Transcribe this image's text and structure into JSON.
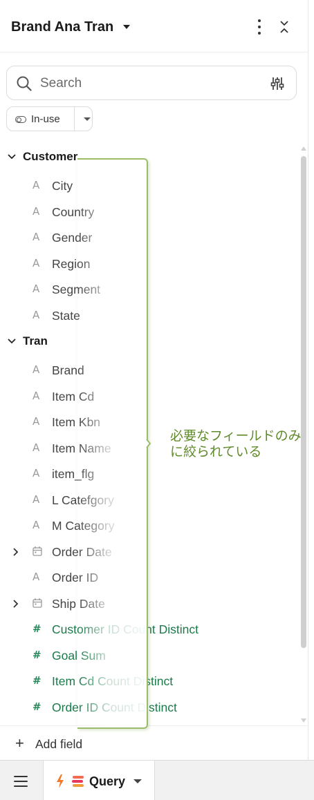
{
  "header": {
    "title": "Brand Ana Tran",
    "icons": [
      "caret-down-icon",
      "more-vert-icon",
      "collapse-icon"
    ]
  },
  "search": {
    "placeholder": "Search",
    "icons": [
      "search-icon",
      "filter-sliders-icon"
    ]
  },
  "filter_toggle": {
    "label": "In-use",
    "icons": [
      "toggle-icon",
      "caret-down-icon"
    ]
  },
  "groups": [
    {
      "label": "Customer",
      "fields": [
        {
          "label": "City",
          "type": "dimension"
        },
        {
          "label": "Country",
          "type": "dimension"
        },
        {
          "label": "Gender",
          "type": "dimension"
        },
        {
          "label": "Region",
          "type": "dimension"
        },
        {
          "label": "Segment",
          "type": "dimension"
        },
        {
          "label": "State",
          "type": "dimension"
        }
      ]
    },
    {
      "label": "Tran",
      "fields": [
        {
          "label": "Brand",
          "type": "dimension"
        },
        {
          "label": "Item Cd",
          "type": "dimension"
        },
        {
          "label": "Item Kbn",
          "type": "dimension"
        },
        {
          "label": "Item Name",
          "type": "dimension"
        },
        {
          "label": "item_flg",
          "type": "dimension"
        },
        {
          "label": "L Catefgory",
          "type": "dimension"
        },
        {
          "label": "M Category",
          "type": "dimension"
        },
        {
          "label": "Order Date",
          "type": "date"
        },
        {
          "label": "Order ID",
          "type": "dimension"
        },
        {
          "label": "Ship Date",
          "type": "date"
        },
        {
          "label": "Customer ID Count Distinct",
          "type": "measure"
        },
        {
          "label": "Goal Sum",
          "type": "measure"
        },
        {
          "label": "Item Cd Count Distinct",
          "type": "measure"
        },
        {
          "label": "Order ID Count Distinct",
          "type": "measure"
        }
      ]
    }
  ],
  "annotation": {
    "text_line1": "必要なフィールドのみ",
    "text_line2": "に絞られている",
    "color": "#5f8a2a"
  },
  "add_field": {
    "label": "Add field",
    "icon": "plus-icon"
  },
  "bottom_bar": {
    "menu_icon": "hamburger-icon",
    "tab_label": "Query",
    "tab_icons": [
      "bolt-icon",
      "stack-icon",
      "caret-down-icon"
    ]
  },
  "colors": {
    "measure": "#1b7a4a",
    "dimension_text": "#444444",
    "annotation_border": "#9bbd6a"
  }
}
